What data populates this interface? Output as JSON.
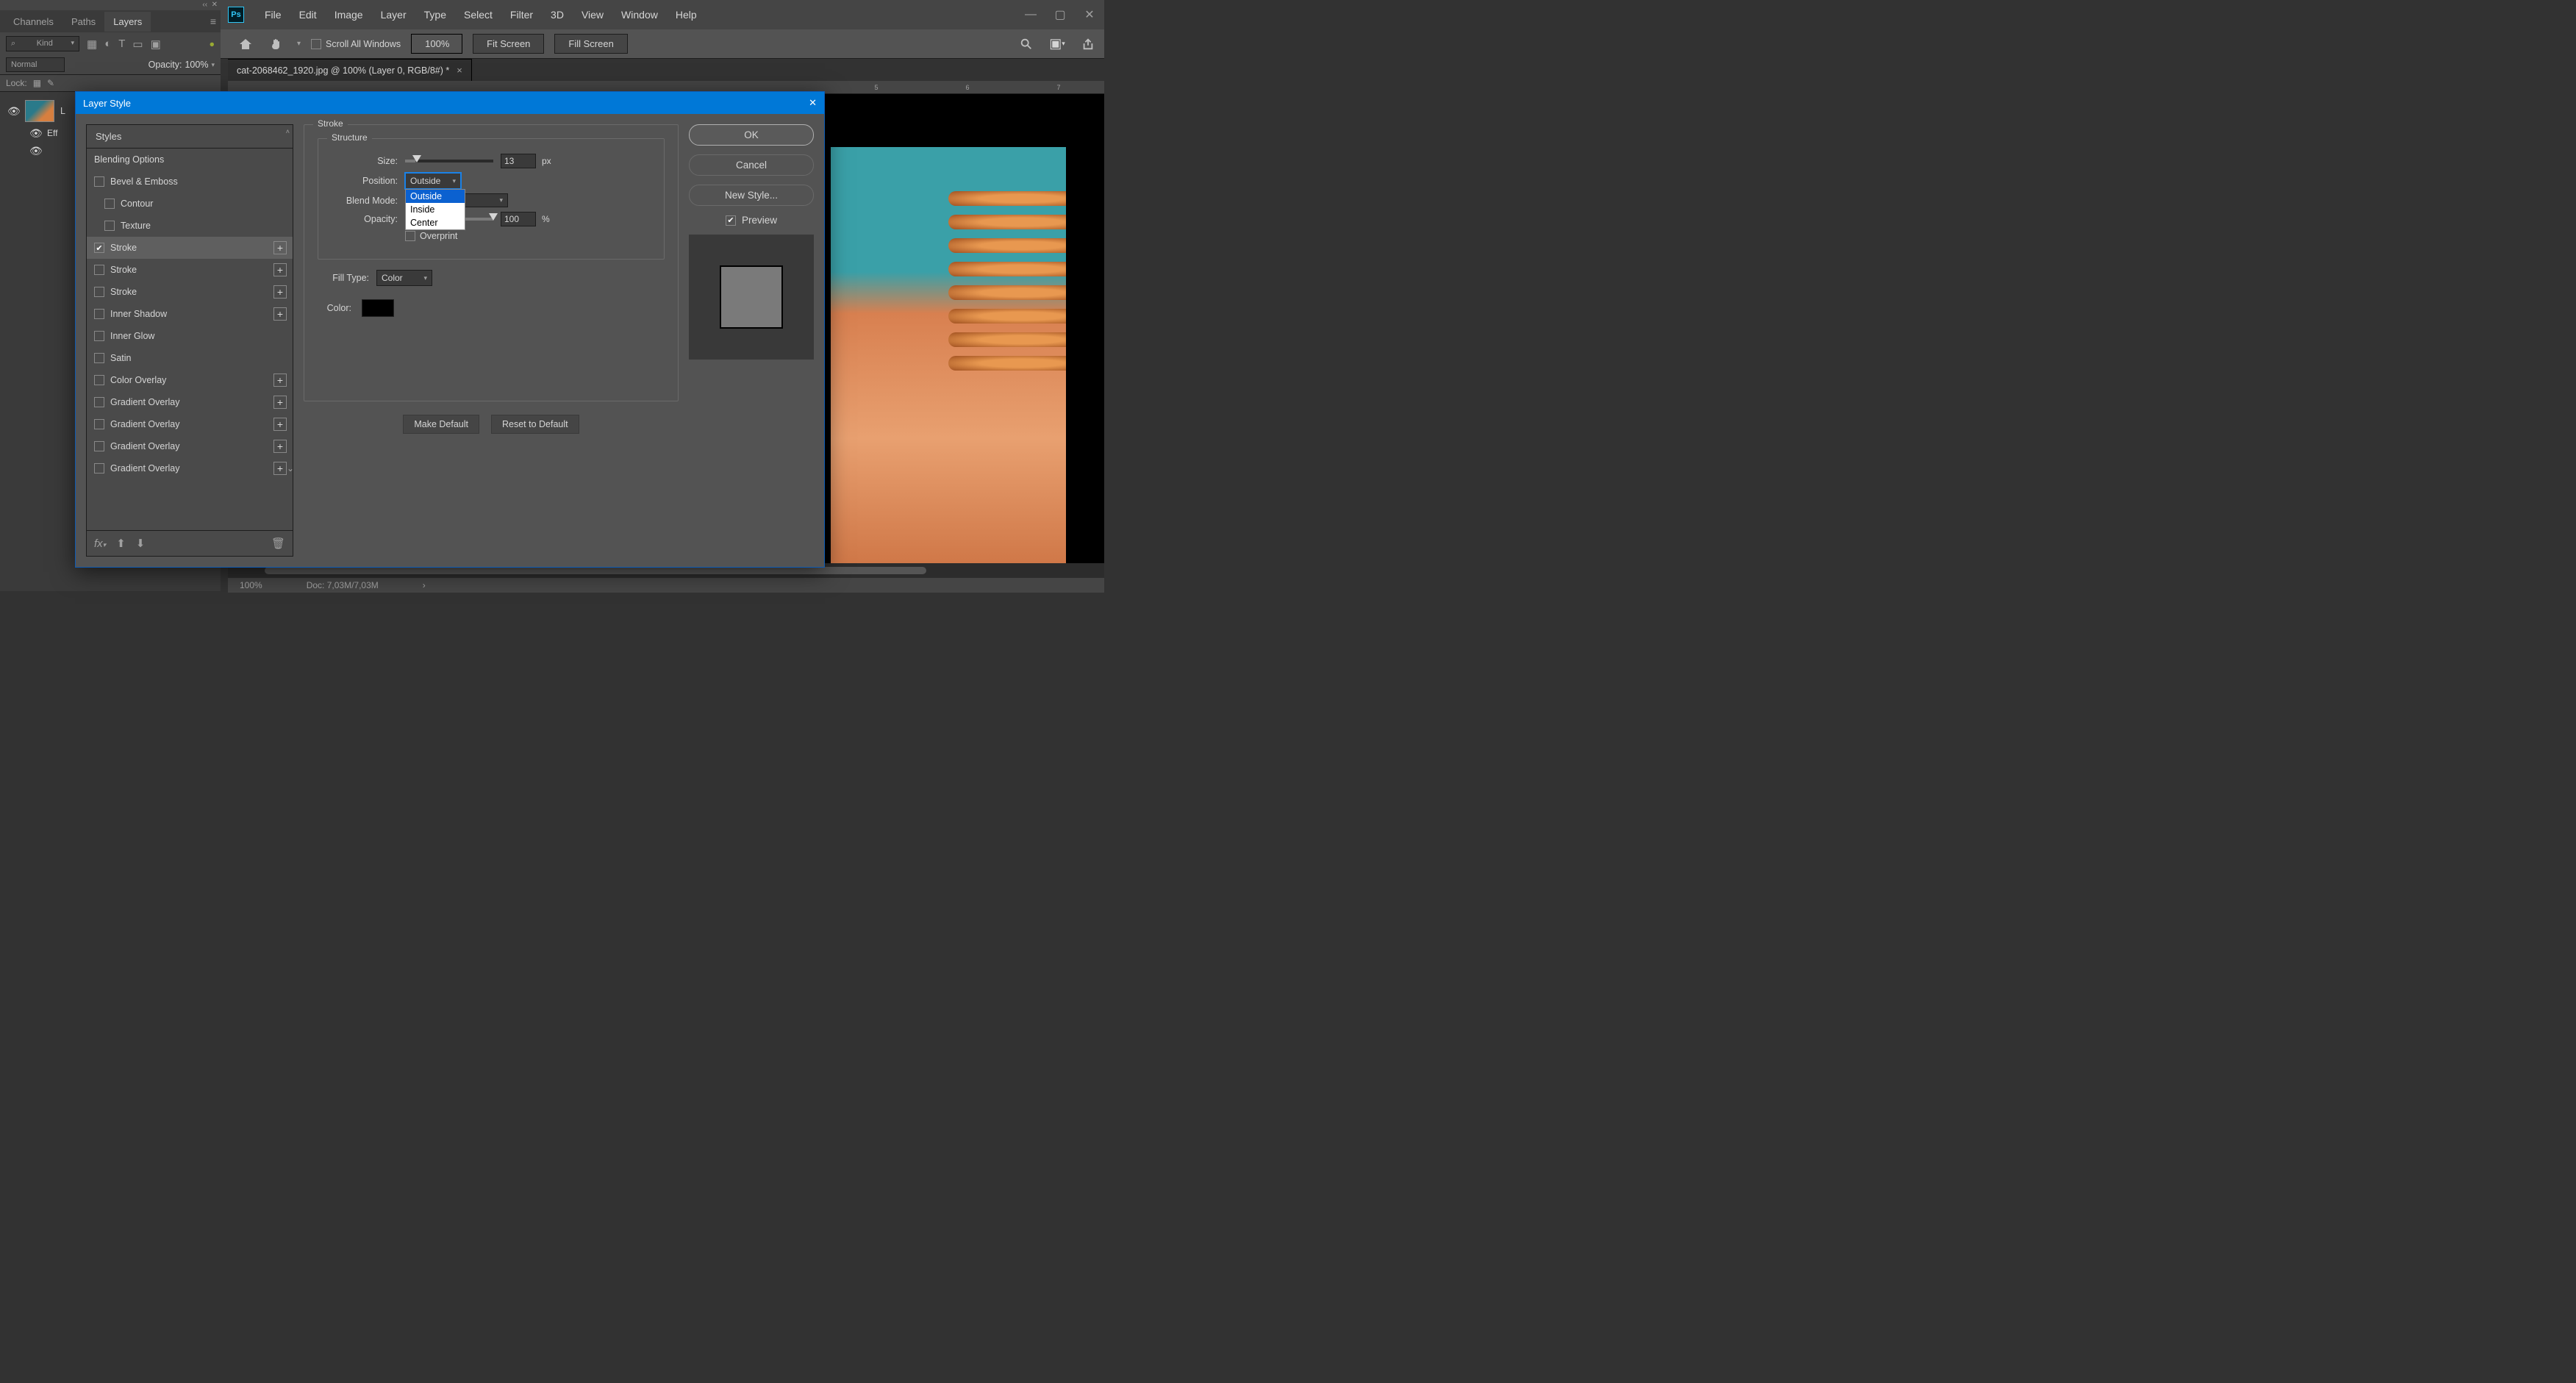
{
  "menubar": {
    "items": [
      "File",
      "Edit",
      "Image",
      "Layer",
      "Type",
      "Select",
      "Filter",
      "3D",
      "View",
      "Window",
      "Help"
    ]
  },
  "options": {
    "scroll_all_label": "Scroll All Windows",
    "zoom_value": "100%",
    "fit_screen_label": "Fit Screen",
    "fill_screen_label": "Fill Screen"
  },
  "doc_tab": {
    "title": "cat-2068462_1920.jpg @ 100% (Layer 0, RGB/8#) *"
  },
  "left_panel": {
    "tabs": [
      "Channels",
      "Paths",
      "Layers"
    ],
    "kind_label": "Kind",
    "blend_mode": "Normal",
    "opacity_label": "Opacity:",
    "opacity_value": "100%",
    "lock_label": "Lock:",
    "layers": [
      {
        "name": "L"
      },
      {
        "name": "Eff"
      }
    ]
  },
  "ruler_ticks": [
    "5",
    "6",
    "7"
  ],
  "status": {
    "zoom": "100%",
    "doc": "Doc: 7,03M/7,03M"
  },
  "dialog": {
    "title": "Layer Style",
    "styles_header": "Styles",
    "blending_options_label": "Blending Options",
    "styles_list": [
      {
        "label": "Bevel & Emboss",
        "checked": false,
        "indent": false,
        "plus": false
      },
      {
        "label": "Contour",
        "checked": false,
        "indent": true,
        "plus": false
      },
      {
        "label": "Texture",
        "checked": false,
        "indent": true,
        "plus": false
      },
      {
        "label": "Stroke",
        "checked": true,
        "indent": false,
        "plus": true,
        "selected": true
      },
      {
        "label": "Stroke",
        "checked": false,
        "indent": false,
        "plus": true
      },
      {
        "label": "Stroke",
        "checked": false,
        "indent": false,
        "plus": true
      },
      {
        "label": "Inner Shadow",
        "checked": false,
        "indent": false,
        "plus": true
      },
      {
        "label": "Inner Glow",
        "checked": false,
        "indent": false,
        "plus": false
      },
      {
        "label": "Satin",
        "checked": false,
        "indent": false,
        "plus": false
      },
      {
        "label": "Color Overlay",
        "checked": false,
        "indent": false,
        "plus": true
      },
      {
        "label": "Gradient Overlay",
        "checked": false,
        "indent": false,
        "plus": true
      },
      {
        "label": "Gradient Overlay",
        "checked": false,
        "indent": false,
        "plus": true
      },
      {
        "label": "Gradient Overlay",
        "checked": false,
        "indent": false,
        "plus": true
      },
      {
        "label": "Gradient Overlay",
        "checked": false,
        "indent": false,
        "plus": true
      }
    ],
    "stroke": {
      "group_label": "Stroke",
      "structure_label": "Structure",
      "size_label": "Size:",
      "size_value": "13",
      "size_unit": "px",
      "position_label": "Position:",
      "position_value": "Outside",
      "position_options": [
        "Outside",
        "Inside",
        "Center"
      ],
      "blend_mode_label": "Blend Mode:",
      "opacity_label": "Opacity:",
      "opacity_value": "100",
      "opacity_unit": "%",
      "overprint_label": "Overprint",
      "fill_type_label": "Fill Type:",
      "fill_type_value": "Color",
      "color_label": "Color:"
    },
    "make_default_label": "Make Default",
    "reset_default_label": "Reset to Default",
    "ok_label": "OK",
    "cancel_label": "Cancel",
    "new_style_label": "New Style...",
    "preview_label": "Preview"
  }
}
